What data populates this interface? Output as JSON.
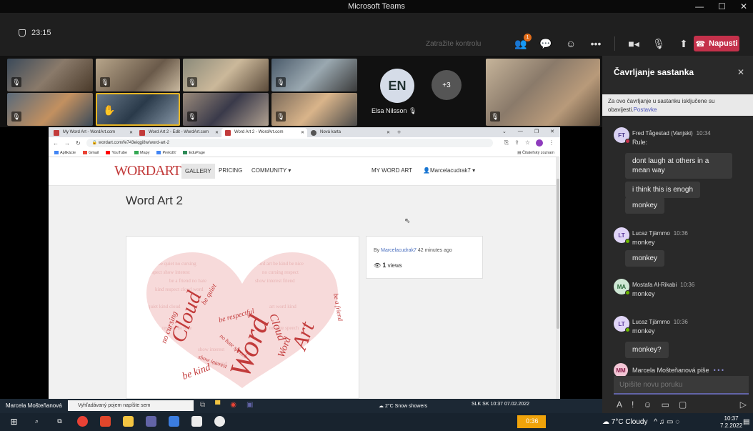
{
  "app_title": "Microsoft Teams",
  "toolbar": {
    "timer": "23:15",
    "request_control": "Zatražite kontrolu",
    "participants_badge": "1",
    "leave_label": "Napusti"
  },
  "gallery": {
    "avatar_initials": "EN",
    "avatar_name": "Elsa Nilsson",
    "more_count": "+3"
  },
  "chat": {
    "title": "Čavrljanje sastanka",
    "notice": "Za ovo čavrljanje u sastanku isključene su obavijesti.",
    "notice_link": "Postavke",
    "messages": [
      {
        "initials": "FT",
        "author": "Fred Tågestad (Vanjski)",
        "time": "10:34",
        "inline": "Rule:"
      },
      {
        "initials": "LT",
        "author": "Lucaz Tjärnmo",
        "time": "10:36",
        "inline": "monkey"
      },
      {
        "initials": "MA",
        "author": "Mostafa Al-Rikabi",
        "time": "10:36",
        "inline": "monkey"
      },
      {
        "initials": "LT",
        "author": "Lucaz Tjärnmo",
        "time": "10:36",
        "inline": "monkey"
      }
    ],
    "bubbles": [
      "dont laugh at others in a mean way",
      "i think this is enogh",
      "monkey",
      "monkey",
      "monkey?"
    ],
    "typing_initials": "MM",
    "typing_text": "Marcela Mošteňanová piše",
    "input_placeholder": "Upišite novu poruku"
  },
  "browser": {
    "tabs": [
      "My Word Art - WordArt.com",
      "Word Art 2 - Edit - WordArt.com",
      "Word Art 2 - WordArt.com",
      "Nová karta"
    ],
    "url": "wordart.com/fe743eiqgi8w/word-art-2",
    "bookmarks": [
      "Aplikácie",
      "Gmail",
      "YouTube",
      "Mapy",
      "Preložiť",
      "EduPage"
    ],
    "reading_list": "Čitateľský zoznam"
  },
  "wordart": {
    "logo": "WORDART",
    "nav": [
      "GALLERY",
      "PRICING",
      "COMMUNITY ▾"
    ],
    "my_word_art": "MY WORD ART",
    "user": "Marcelacudrak7",
    "title": "Word Art 2",
    "by_label": "By",
    "author": "Marcelacudrak7",
    "ago": "42 minutes ago",
    "views_count": "1",
    "views_label": "views",
    "cloud_words": [
      "Cloud",
      "Word",
      "Art",
      "be kind",
      "no cursing",
      "be quiet",
      "be respectful",
      "no hate speech",
      "show interest",
      "be a friend",
      "Cloud",
      "Word"
    ]
  },
  "inner_taskbar": {
    "sharer": "Marcela Mošteňanová",
    "search_placeholder": "Vyhľadávaný pojem napíšte sem",
    "weather": "2°C Snow showers",
    "lang": "SLK SK",
    "time": "10:37",
    "date": "07.02.2022"
  },
  "os_taskbar": {
    "clip_time": "0:36",
    "weather": "7°C Cloudy",
    "time": "10:37",
    "date": "7.2.2022"
  },
  "colors": {
    "accent": "#6264a7",
    "leave": "#c4314b",
    "wordart_red": "#c23b3b",
    "highlight": "#e8b624"
  }
}
